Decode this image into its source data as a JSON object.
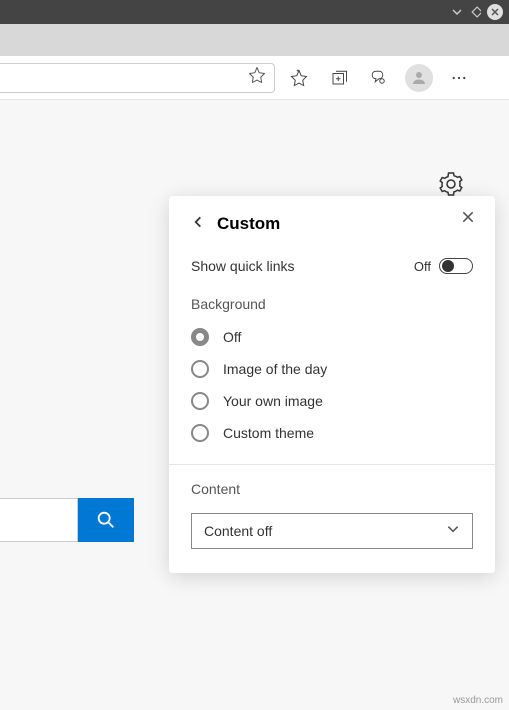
{
  "panel": {
    "title": "Custom",
    "quick_links": {
      "label": "Show quick links",
      "state_text": "Off"
    },
    "background": {
      "heading": "Background",
      "options": [
        "Off",
        "Image of the day",
        "Your own image",
        "Custom theme"
      ],
      "selected": 0
    },
    "content": {
      "heading": "Content",
      "selected_value": "Content off"
    }
  },
  "watermark": "wsxdn.com"
}
